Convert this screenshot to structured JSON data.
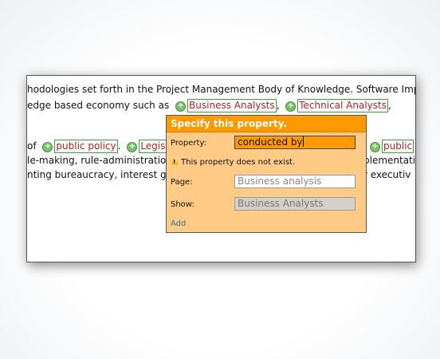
{
  "text": {
    "l1": "hodologies set forth in the Project Management Body of Knowledge. Software Implem",
    "l2_prefix": "edge based economy such as",
    "l2_tag1": "Business Analysts",
    "l2_sep": ",",
    "l2_tag2": "Technical Analysts",
    "l2_suffix": ",",
    "l3_prefix": "of",
    "l3_tag1": "public policy",
    "l3_sep": ".",
    "l3_tag2": "Legislat",
    "l3_tag3": "public",
    "l4_left": "le-making, rule-administration",
    "l4_right": "plementatio",
    "l5_left": "nting bureaucracy, interest gro",
    "l5_right": "r executiv"
  },
  "popup": {
    "title": "Specify this property.",
    "property_label": "Property:",
    "property_value": "conducted by",
    "warning": "This property does not exist.",
    "page_label": "Page:",
    "page_placeholder": "Business analysis",
    "show_label": "Show:",
    "show_placeholder": "Business Analysts",
    "add_label": "Add"
  },
  "colors": {
    "popup_bg": "#ffcb86",
    "popup_header": "#ff9900",
    "tag_border": "#39a339",
    "tag_text": "#b22222"
  }
}
